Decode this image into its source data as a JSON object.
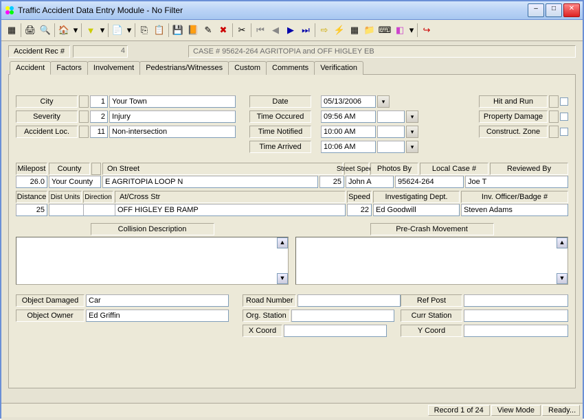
{
  "window": {
    "title": "Traffic Accident Data Entry Module - No Filter"
  },
  "header": {
    "rec_label": "Accident Rec #",
    "rec_num": "4",
    "case": "CASE # 95624-264  AGRITOPIA and OFF HIGLEY EB"
  },
  "tabs": [
    "Accident",
    "Factors",
    "Involvement",
    "Pedestrians/Witnesses",
    "Custom",
    "Comments",
    "Verification"
  ],
  "labels": {
    "city": "City",
    "severity": "Severity",
    "acc_loc": "Accident Loc.",
    "date": "Date",
    "time_occured": "Time Occured",
    "time_notified": "Time Notified",
    "time_arrived": "Time Arrived",
    "hit_run": "Hit and Run",
    "prop_dmg": "Property Damage",
    "con_zone": "Construct. Zone",
    "milepost": "Milepost",
    "county": "County",
    "on_street": "On Street",
    "street_speed": "Street Speed",
    "photos_by": "Photos By",
    "local_case": "Local Case #",
    "reviewed_by": "Reviewed By",
    "distance": "Distance",
    "dist_units": "Dist Units",
    "direction": "Direction",
    "at_cross": "At/Cross Str",
    "speed": "Speed",
    "inv_dept": "Investigating Dept.",
    "inv_officer": "Inv. Officer/Badge #",
    "collision_desc": "Collision Description",
    "precrash": "Pre-Crash Movement",
    "obj_dmg": "Object Damaged",
    "obj_owner": "Object Owner",
    "road_num": "Road Number",
    "org_station": "Org. Station",
    "x_coord": "X Coord",
    "ref_post": "Ref Post",
    "curr_station": "Curr Station",
    "y_coord": "Y Coord"
  },
  "values": {
    "city_code": "1",
    "city": "Your Town",
    "severity_code": "2",
    "severity": "Injury",
    "acc_loc_code": "11",
    "acc_loc": "Non-intersection",
    "date": "05/13/2006",
    "time_occured": "09:56 AM",
    "time_notified": "10:00 AM",
    "time_arrived": "10:06 AM",
    "milepost": "26.0",
    "county": "Your County",
    "on_street": "E AGRITOPIA LOOP N",
    "street_speed": "25",
    "photos_by": "John A",
    "local_case": "95624-264",
    "reviewed_by": "Joe T",
    "distance": "25",
    "dist_units": "",
    "direction": "",
    "at_cross": "OFF HIGLEY EB RAMP",
    "speed": "22",
    "inv_dept": "Ed Goodwill",
    "inv_officer": "Steven Adams",
    "obj_dmg": "Car",
    "obj_owner": "Ed Griffin",
    "road_num": "",
    "org_station": "",
    "x_coord": "",
    "ref_post": "",
    "curr_station": "",
    "y_coord": ""
  },
  "status": {
    "record": "Record 1 of 24",
    "mode": "View Mode",
    "ready": "Ready..."
  }
}
